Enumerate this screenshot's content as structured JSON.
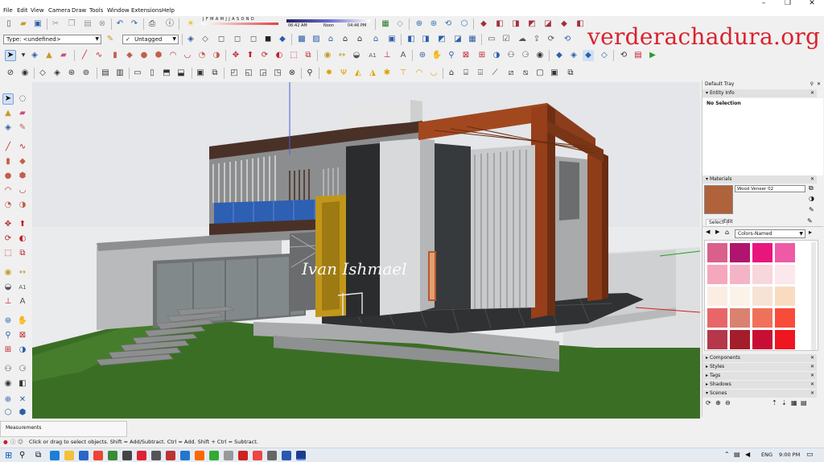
{
  "menu": [
    "File",
    "Edit",
    "View",
    "Camera",
    "Draw",
    "Tools",
    "Window",
    "Extensions",
    "Help"
  ],
  "window_controls": [
    "–",
    "❐",
    "✕"
  ],
  "toolbar": {
    "tag_combo": "Type: <undefined>",
    "untagged_combo": "Untagged",
    "untagged_check": "✓",
    "shadow_months": "J F M A M J J A S O N D",
    "shadow_time_start": "06:42 AM",
    "shadow_time_noon": "Noon",
    "shadow_time_end": "04:46 PM"
  },
  "watermark": "verderachadura.org",
  "signature": "Ivan Ishmael",
  "tray": {
    "title": "Default Tray",
    "entity_info_header": "Entity Info",
    "entity_info_value": "No Selection",
    "materials_header": "Materials",
    "material_name": "Wood Veneer 02",
    "tabs": [
      "Select",
      "Edit"
    ],
    "library_dropdown": "Colors-Named",
    "swatch_colors": [
      "#d9608a",
      "#b1146e",
      "#e8157d",
      "#ee5aa5",
      "#f4a7bd",
      "#f4b4c7",
      "#f7d6dc",
      "#fbe7ec",
      "#faeee2",
      "#fbf2e8",
      "#f6e3d6",
      "#f9dcc0",
      "#e8666a",
      "#d9826f",
      "#f0715a",
      "#f94b3a",
      "#b5374a",
      "#a41d2a",
      "#c90e36",
      "#ee1620"
    ],
    "collapsed_panels": [
      "Components",
      "Styles",
      "Tags",
      "Shadows",
      "Scenes"
    ]
  },
  "measurements_label": "Measurements",
  "status_text": "Click or drag to select objects. Shift = Add/Subtract. Ctrl = Add. Shift + Ctrl = Subtract.",
  "taskbar": {
    "lang": "ENG",
    "time": "9:00 PM"
  },
  "colors": {
    "sky": "#e9ebed",
    "lawn": "#3b6e25",
    "wood": "#8b3d1c",
    "accent_red": "#d9232e"
  }
}
